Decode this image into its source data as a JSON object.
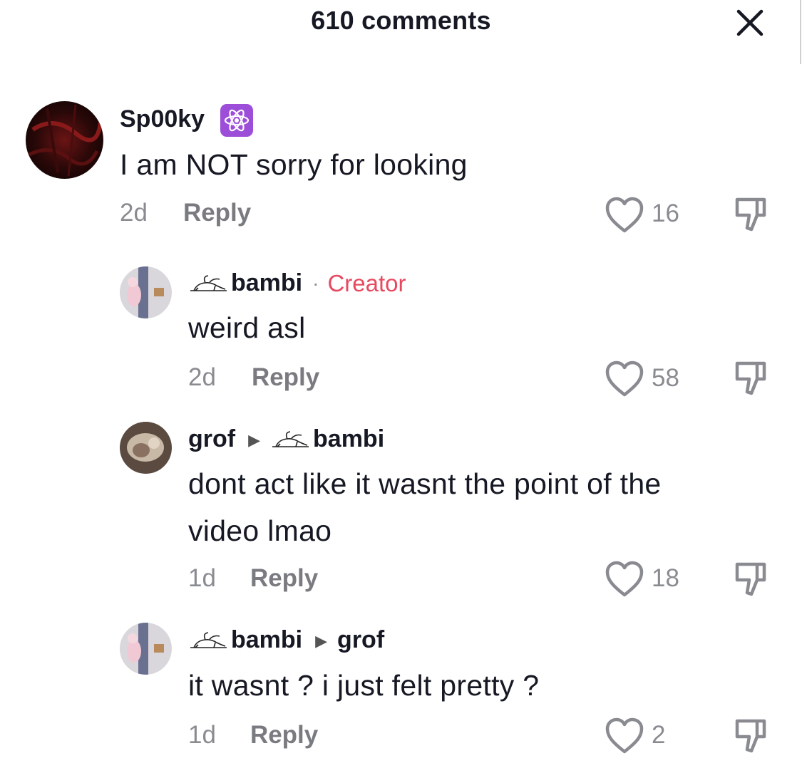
{
  "header": {
    "title": "610 comments"
  },
  "comments": [
    {
      "username": "Sp00ky",
      "badge": "atom-icon",
      "text_lines": [
        "I am NOT sorry for looking"
      ],
      "time": "2d",
      "reply_label": "Reply",
      "likes": "16"
    },
    {
      "username": "bambi",
      "separator": "·",
      "role": "Creator",
      "text_lines": [
        "weird asl"
      ],
      "time": "2d",
      "reply_label": "Reply",
      "likes": "58"
    },
    {
      "username": "grof",
      "reply_to": "bambi",
      "text_lines": [
        "dont act like it wasnt the point of the",
        "video lmao"
      ],
      "time": "1d",
      "reply_label": "Reply",
      "likes": "18"
    },
    {
      "username": "bambi",
      "reply_to": "grof",
      "text_lines": [
        "it wasnt ? i just felt pretty ?"
      ],
      "time": "1d",
      "reply_label": "Reply",
      "likes": "2"
    }
  ],
  "colors": {
    "creator": "#e8495f",
    "muted": "#8a8b91",
    "text": "#161823",
    "badge": "#9d4ed8"
  }
}
